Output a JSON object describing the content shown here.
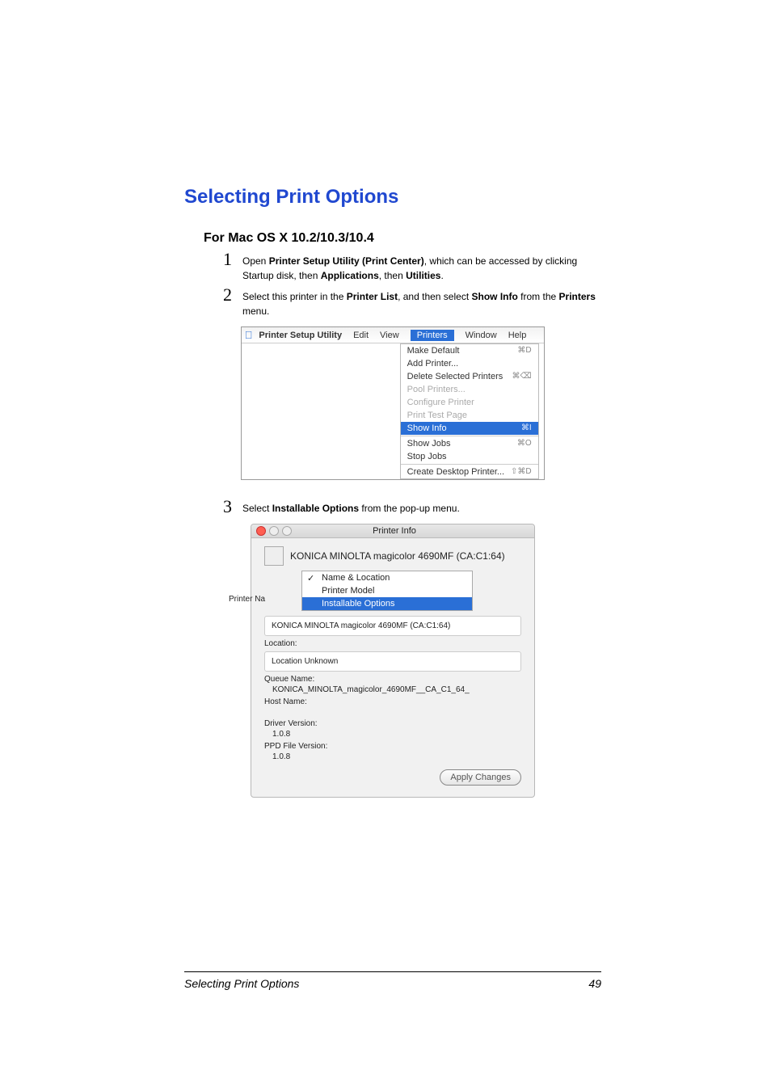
{
  "heading": "Selecting Print Options",
  "subheading": "For Mac OS X 10.2/10.3/10.4",
  "steps": {
    "s1": {
      "num": "1",
      "pre": "Open ",
      "b1": "Printer Setup Utility (Print Center)",
      "mid1": ", which can be accessed by clicking Startup disk, then ",
      "b2": "Applications",
      "mid2": ", then ",
      "b3": "Utilities",
      "end": "."
    },
    "s2": {
      "num": "2",
      "pre": "Select this printer in the ",
      "b1": "Printer List",
      "mid1": ", and then select ",
      "b2": "Show Info",
      "mid2": " from the ",
      "b3": "Printers",
      "end": " menu."
    },
    "s3": {
      "num": "3",
      "pre": "Select ",
      "b1": "Installable Options",
      "end": " from the pop-up menu."
    }
  },
  "fig1": {
    "appTitle": "Printer Setup Utility",
    "menus": {
      "edit": "Edit",
      "view": "View",
      "printers": "Printers",
      "window": "Window",
      "help": "Help"
    },
    "items": {
      "makeDefault": "Make Default",
      "makeDefault_sc": "⌘D",
      "addPrinter": "Add Printer...",
      "deleteSel": "Delete Selected Printers",
      "deleteSel_sc": "⌘⌫",
      "pool": "Pool Printers...",
      "configure": "Configure Printer",
      "testPage": "Print Test Page",
      "showInfo": "Show Info",
      "showInfo_sc": "⌘I",
      "showJobs": "Show Jobs",
      "showJobs_sc": "⌘O",
      "stopJobs": "Stop Jobs",
      "createDesktop": "Create Desktop Printer...",
      "createDesktop_sc": "⇧⌘D"
    }
  },
  "fig2": {
    "winTitle": "Printer Info",
    "printerName": "KONICA MINOLTA magicolor 4690MF (CA:C1:64)",
    "popup": {
      "nameLoc": "Name & Location",
      "printerModel": "Printer Model",
      "installable": "Installable Options"
    },
    "sideLabel": "Printer Na",
    "fields": {
      "nameVal": "KONICA MINOLTA magicolor 4690MF (CA:C1:64)",
      "locationLabel": "Location:",
      "locationVal": "Location Unknown",
      "queueLabel": "Queue Name:",
      "queueVal": "KONICA_MINOLTA_magicolor_4690MF__CA_C1_64_",
      "hostLabel": "Host Name:",
      "driverLabel": "Driver Version:",
      "driverVal": "1.0.8",
      "ppdLabel": "PPD File Version:",
      "ppdVal": "1.0.8"
    },
    "applyBtn": "Apply Changes"
  },
  "footer": {
    "left": "Selecting Print Options",
    "right": "49"
  }
}
